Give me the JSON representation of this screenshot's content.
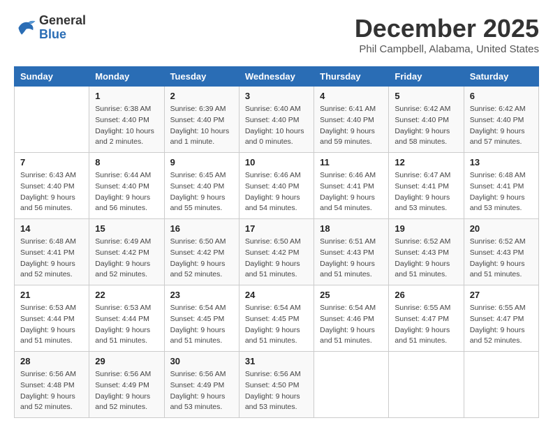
{
  "header": {
    "logo_line1": "General",
    "logo_line2": "Blue",
    "month_title": "December 2025",
    "subtitle": "Phil Campbell, Alabama, United States"
  },
  "days_of_week": [
    "Sunday",
    "Monday",
    "Tuesday",
    "Wednesday",
    "Thursday",
    "Friday",
    "Saturday"
  ],
  "weeks": [
    [
      {
        "num": "",
        "sunrise": "",
        "sunset": "",
        "daylight": ""
      },
      {
        "num": "1",
        "sunrise": "Sunrise: 6:38 AM",
        "sunset": "Sunset: 4:40 PM",
        "daylight": "Daylight: 10 hours and 2 minutes."
      },
      {
        "num": "2",
        "sunrise": "Sunrise: 6:39 AM",
        "sunset": "Sunset: 4:40 PM",
        "daylight": "Daylight: 10 hours and 1 minute."
      },
      {
        "num": "3",
        "sunrise": "Sunrise: 6:40 AM",
        "sunset": "Sunset: 4:40 PM",
        "daylight": "Daylight: 10 hours and 0 minutes."
      },
      {
        "num": "4",
        "sunrise": "Sunrise: 6:41 AM",
        "sunset": "Sunset: 4:40 PM",
        "daylight": "Daylight: 9 hours and 59 minutes."
      },
      {
        "num": "5",
        "sunrise": "Sunrise: 6:42 AM",
        "sunset": "Sunset: 4:40 PM",
        "daylight": "Daylight: 9 hours and 58 minutes."
      },
      {
        "num": "6",
        "sunrise": "Sunrise: 6:42 AM",
        "sunset": "Sunset: 4:40 PM",
        "daylight": "Daylight: 9 hours and 57 minutes."
      }
    ],
    [
      {
        "num": "7",
        "sunrise": "Sunrise: 6:43 AM",
        "sunset": "Sunset: 4:40 PM",
        "daylight": "Daylight: 9 hours and 56 minutes."
      },
      {
        "num": "8",
        "sunrise": "Sunrise: 6:44 AM",
        "sunset": "Sunset: 4:40 PM",
        "daylight": "Daylight: 9 hours and 56 minutes."
      },
      {
        "num": "9",
        "sunrise": "Sunrise: 6:45 AM",
        "sunset": "Sunset: 4:40 PM",
        "daylight": "Daylight: 9 hours and 55 minutes."
      },
      {
        "num": "10",
        "sunrise": "Sunrise: 6:46 AM",
        "sunset": "Sunset: 4:40 PM",
        "daylight": "Daylight: 9 hours and 54 minutes."
      },
      {
        "num": "11",
        "sunrise": "Sunrise: 6:46 AM",
        "sunset": "Sunset: 4:41 PM",
        "daylight": "Daylight: 9 hours and 54 minutes."
      },
      {
        "num": "12",
        "sunrise": "Sunrise: 6:47 AM",
        "sunset": "Sunset: 4:41 PM",
        "daylight": "Daylight: 9 hours and 53 minutes."
      },
      {
        "num": "13",
        "sunrise": "Sunrise: 6:48 AM",
        "sunset": "Sunset: 4:41 PM",
        "daylight": "Daylight: 9 hours and 53 minutes."
      }
    ],
    [
      {
        "num": "14",
        "sunrise": "Sunrise: 6:48 AM",
        "sunset": "Sunset: 4:41 PM",
        "daylight": "Daylight: 9 hours and 52 minutes."
      },
      {
        "num": "15",
        "sunrise": "Sunrise: 6:49 AM",
        "sunset": "Sunset: 4:42 PM",
        "daylight": "Daylight: 9 hours and 52 minutes."
      },
      {
        "num": "16",
        "sunrise": "Sunrise: 6:50 AM",
        "sunset": "Sunset: 4:42 PM",
        "daylight": "Daylight: 9 hours and 52 minutes."
      },
      {
        "num": "17",
        "sunrise": "Sunrise: 6:50 AM",
        "sunset": "Sunset: 4:42 PM",
        "daylight": "Daylight: 9 hours and 51 minutes."
      },
      {
        "num": "18",
        "sunrise": "Sunrise: 6:51 AM",
        "sunset": "Sunset: 4:43 PM",
        "daylight": "Daylight: 9 hours and 51 minutes."
      },
      {
        "num": "19",
        "sunrise": "Sunrise: 6:52 AM",
        "sunset": "Sunset: 4:43 PM",
        "daylight": "Daylight: 9 hours and 51 minutes."
      },
      {
        "num": "20",
        "sunrise": "Sunrise: 6:52 AM",
        "sunset": "Sunset: 4:43 PM",
        "daylight": "Daylight: 9 hours and 51 minutes."
      }
    ],
    [
      {
        "num": "21",
        "sunrise": "Sunrise: 6:53 AM",
        "sunset": "Sunset: 4:44 PM",
        "daylight": "Daylight: 9 hours and 51 minutes."
      },
      {
        "num": "22",
        "sunrise": "Sunrise: 6:53 AM",
        "sunset": "Sunset: 4:44 PM",
        "daylight": "Daylight: 9 hours and 51 minutes."
      },
      {
        "num": "23",
        "sunrise": "Sunrise: 6:54 AM",
        "sunset": "Sunset: 4:45 PM",
        "daylight": "Daylight: 9 hours and 51 minutes."
      },
      {
        "num": "24",
        "sunrise": "Sunrise: 6:54 AM",
        "sunset": "Sunset: 4:45 PM",
        "daylight": "Daylight: 9 hours and 51 minutes."
      },
      {
        "num": "25",
        "sunrise": "Sunrise: 6:54 AM",
        "sunset": "Sunset: 4:46 PM",
        "daylight": "Daylight: 9 hours and 51 minutes."
      },
      {
        "num": "26",
        "sunrise": "Sunrise: 6:55 AM",
        "sunset": "Sunset: 4:47 PM",
        "daylight": "Daylight: 9 hours and 51 minutes."
      },
      {
        "num": "27",
        "sunrise": "Sunrise: 6:55 AM",
        "sunset": "Sunset: 4:47 PM",
        "daylight": "Daylight: 9 hours and 52 minutes."
      }
    ],
    [
      {
        "num": "28",
        "sunrise": "Sunrise: 6:56 AM",
        "sunset": "Sunset: 4:48 PM",
        "daylight": "Daylight: 9 hours and 52 minutes."
      },
      {
        "num": "29",
        "sunrise": "Sunrise: 6:56 AM",
        "sunset": "Sunset: 4:49 PM",
        "daylight": "Daylight: 9 hours and 52 minutes."
      },
      {
        "num": "30",
        "sunrise": "Sunrise: 6:56 AM",
        "sunset": "Sunset: 4:49 PM",
        "daylight": "Daylight: 9 hours and 53 minutes."
      },
      {
        "num": "31",
        "sunrise": "Sunrise: 6:56 AM",
        "sunset": "Sunset: 4:50 PM",
        "daylight": "Daylight: 9 hours and 53 minutes."
      },
      {
        "num": "",
        "sunrise": "",
        "sunset": "",
        "daylight": ""
      },
      {
        "num": "",
        "sunrise": "",
        "sunset": "",
        "daylight": ""
      },
      {
        "num": "",
        "sunrise": "",
        "sunset": "",
        "daylight": ""
      }
    ]
  ]
}
